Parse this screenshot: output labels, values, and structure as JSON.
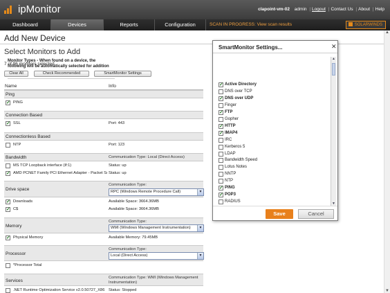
{
  "app": {
    "name": "ipMonitor",
    "host": "clapoint-vm-02",
    "user": "admin",
    "links": [
      "Logout",
      "Contact Us",
      "About",
      "Help"
    ]
  },
  "nav": {
    "tabs": [
      "Dashboard",
      "Devices",
      "Reports",
      "Configuration"
    ],
    "active": "Devices",
    "scan_notice": "SCAN IN PROGRESS: View scan results",
    "brand": "SOLARWINDS"
  },
  "page": {
    "title": "Add New Device",
    "subtitle": "Select Monitors to Add",
    "count": "7 of 96 monitors selected.",
    "buttons": [
      "Clear All",
      "Check Recommended",
      "SmartMonitor Settings"
    ],
    "columns": {
      "name": "Name",
      "info": "Info"
    }
  },
  "sections": {
    "ping": {
      "name": "Ping",
      "row": {
        "label": "PING",
        "checked": true
      }
    },
    "conn": {
      "name": "Connection Based",
      "row": {
        "label": "SSL",
        "info": "Port: 443",
        "checked": true
      }
    },
    "connless": {
      "name": "Connectionless Based",
      "row": {
        "label": "NTP",
        "info": "Port: 123",
        "checked": false
      }
    },
    "bandwidth": {
      "name": "Bandwidth",
      "comm": "Communication Type: Local (Direct Access)",
      "rows": [
        {
          "label": "MS TCP Loopback interface (If:1)",
          "info": "Status: up",
          "checked": false
        },
        {
          "label": "AMD PCNET Family PCI Ethernet Adapter - Packet Sc",
          "info": "Status: up",
          "checked": true
        }
      ]
    },
    "drive": {
      "name": "Drive space",
      "comm_label": "Communication Type:",
      "comm_value": "RPC (Windows Remote Procedure Call)",
      "rows": [
        {
          "label": "Downloads",
          "info": "Available Space: 3664.36MB",
          "checked": true
        },
        {
          "label": "C$",
          "info": "Available Space: 3664.36MB",
          "checked": true
        }
      ]
    },
    "memory": {
      "name": "Memory",
      "comm_label": "Communication Type:",
      "comm_value": "WMI (Windows Management Instrumentation)",
      "row": {
        "label": "Physical Memory",
        "info": "Available Memory: 79.45MB",
        "checked": true
      }
    },
    "processor": {
      "name": "Processor",
      "comm_label": "Communication Type:",
      "comm_value": "Local (Direct Access)",
      "row": {
        "label": "*Processor Total",
        "checked": false
      }
    },
    "services": {
      "name": "Services",
      "comm": "Communication Type: WMI (Windows Management Instrumentation)",
      "row": {
        "label": ".NET Runtime Optimization Service v2.0.50727_X86",
        "info": "Status: Stopped",
        "checked": false
      }
    }
  },
  "modal": {
    "title": "SmartMonitor Settings...",
    "description": "Monitor Types - When found on a device, the following will be automatically selected for addition",
    "items": [
      {
        "label": "Active Directory",
        "checked": true
      },
      {
        "label": "DNS over TCP",
        "checked": false
      },
      {
        "label": "DNS over UDP",
        "checked": true
      },
      {
        "label": "Finger",
        "checked": false
      },
      {
        "label": "FTP",
        "checked": true
      },
      {
        "label": "Gopher",
        "checked": false
      },
      {
        "label": "HTTP",
        "checked": true
      },
      {
        "label": "IMAP4",
        "checked": true
      },
      {
        "label": "IRC",
        "checked": false
      },
      {
        "label": "Kerberos 5",
        "checked": false
      },
      {
        "label": "LDAP",
        "checked": false
      },
      {
        "label": "Bandwidth Speed",
        "checked": false
      },
      {
        "label": "Lotus Notes",
        "checked": false
      },
      {
        "label": "NNTP",
        "checked": false
      },
      {
        "label": "NTP",
        "checked": false
      },
      {
        "label": "PING",
        "checked": true
      },
      {
        "label": "POP3",
        "checked": true
      },
      {
        "label": "RADIUS",
        "checked": false
      }
    ],
    "save": "Save",
    "cancel": "Cancel"
  },
  "colors": {
    "accent": "#e8801c",
    "header": "#4a4a4a",
    "section_bg": "#e8e8e8"
  },
  "icons": [
    "close-icon",
    "checkbox-icon",
    "chevron-down-icon",
    "scroll-up-icon",
    "scroll-down-icon"
  ]
}
